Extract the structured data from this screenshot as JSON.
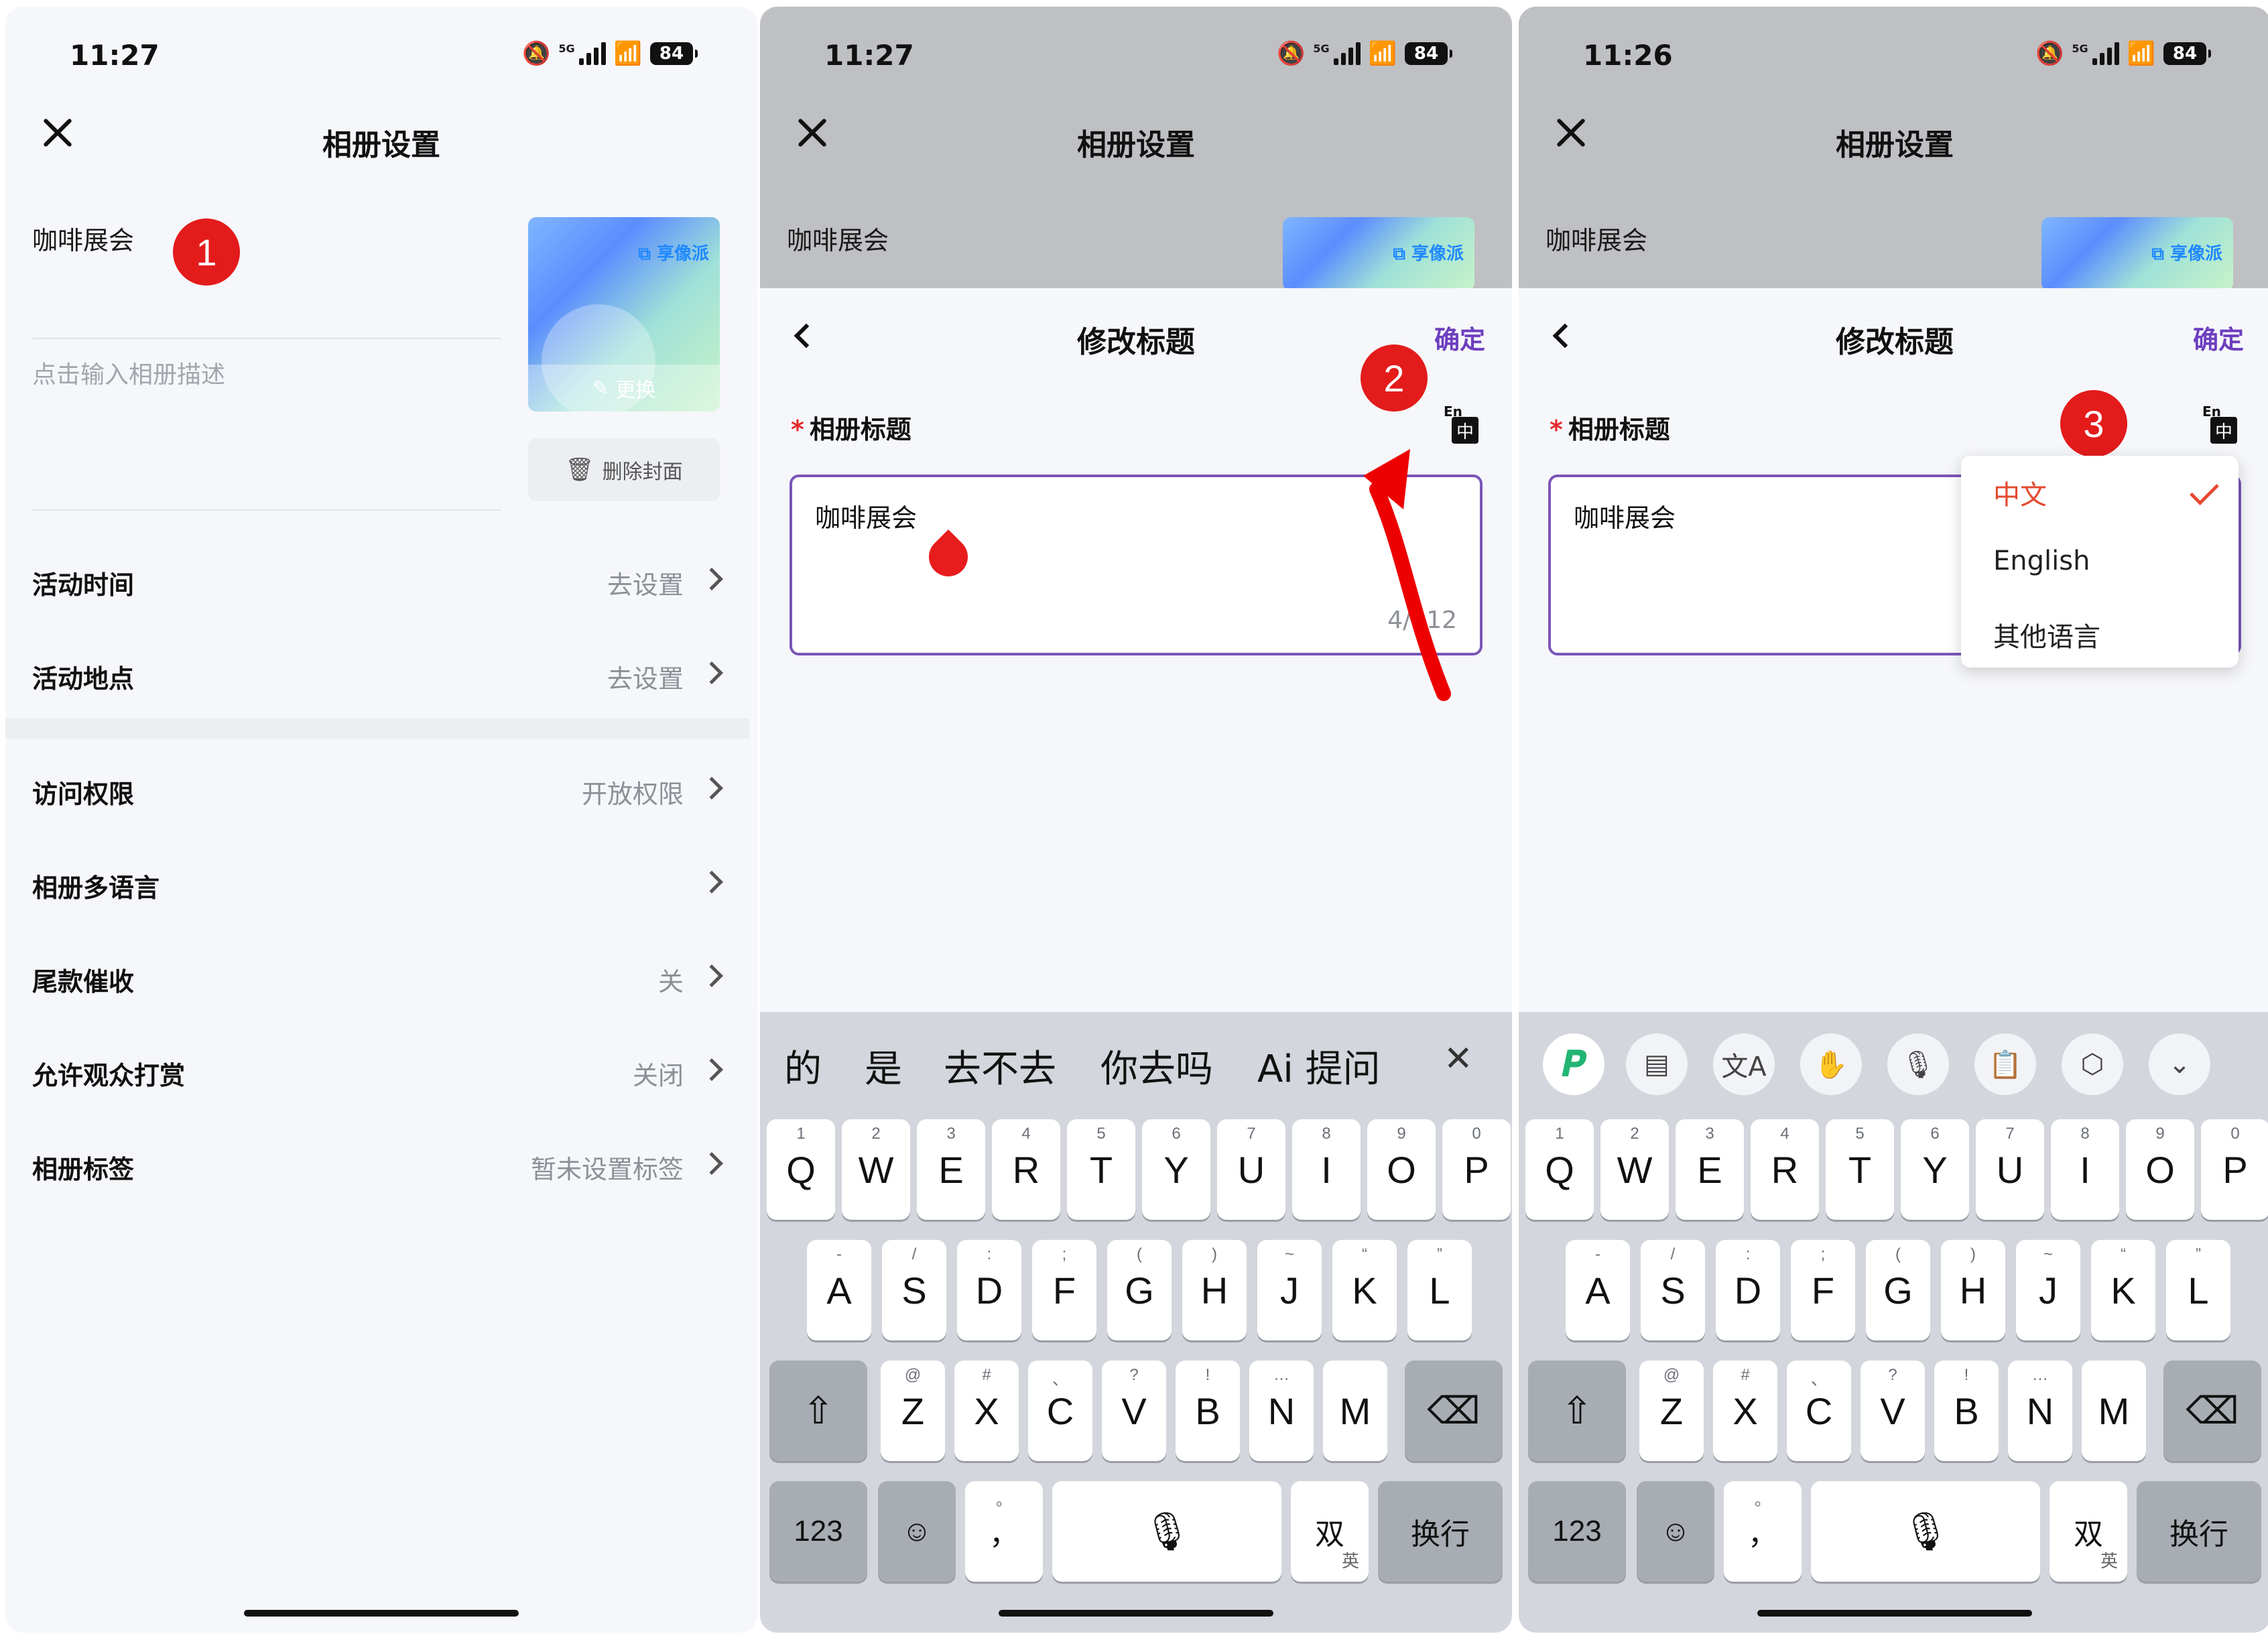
{
  "status": {
    "p1_time": "11:27",
    "p2_time": "11:27",
    "p3_time": "11:26",
    "network": "5G",
    "battery": "84"
  },
  "screen1": {
    "title": "相册设置",
    "album_name": "咖啡展会",
    "description_placeholder": "点击输入相册描述",
    "cover_watermark": "享像派",
    "cover_change": "更换",
    "delete_cover": "删除封面",
    "rows": [
      {
        "label": "活动时间",
        "value": "去设置"
      },
      {
        "label": "活动地点",
        "value": "去设置"
      },
      {
        "label": "访问权限",
        "value": "开放权限"
      },
      {
        "label": "相册多语言",
        "value": ""
      },
      {
        "label": "尾款催收",
        "value": "关"
      },
      {
        "label": "允许观众打赏",
        "value": "关闭"
      },
      {
        "label": "相册标签",
        "value": "暂未设置标签"
      }
    ],
    "badge": "1"
  },
  "sheet": {
    "title": "修改标题",
    "confirm": "确定",
    "field_label": "相册标题",
    "required_mark": "*",
    "value": "咖啡展会",
    "counter": "4/512",
    "lang_icon_en": "En",
    "lang_icon_zh": "中"
  },
  "screen2": {
    "badge": "2",
    "candidates": [
      "的",
      "是",
      "去不去",
      "你去吗",
      "Ai 提问"
    ]
  },
  "screen3": {
    "badge": "3",
    "menu": [
      {
        "label": "中文",
        "selected": true
      },
      {
        "label": "English",
        "selected": false
      },
      {
        "label": "其他语言",
        "selected": false
      }
    ]
  },
  "keyboard": {
    "row1": [
      {
        "k": "Q",
        "s": "1"
      },
      {
        "k": "W",
        "s": "2"
      },
      {
        "k": "E",
        "s": "3"
      },
      {
        "k": "R",
        "s": "4"
      },
      {
        "k": "T",
        "s": "5"
      },
      {
        "k": "Y",
        "s": "6"
      },
      {
        "k": "U",
        "s": "7"
      },
      {
        "k": "I",
        "s": "8"
      },
      {
        "k": "O",
        "s": "9"
      },
      {
        "k": "P",
        "s": "0"
      }
    ],
    "row2": [
      {
        "k": "A",
        "s": "-"
      },
      {
        "k": "S",
        "s": "/"
      },
      {
        "k": "D",
        "s": ":"
      },
      {
        "k": "F",
        "s": ";"
      },
      {
        "k": "G",
        "s": "("
      },
      {
        "k": "H",
        "s": ")"
      },
      {
        "k": "J",
        "s": "~"
      },
      {
        "k": "K",
        "s": "“"
      },
      {
        "k": "L",
        "s": "”"
      }
    ],
    "row3": [
      {
        "k": "Z",
        "s": "@"
      },
      {
        "k": "X",
        "s": "#"
      },
      {
        "k": "C",
        "s": "、"
      },
      {
        "k": "V",
        "s": "?"
      },
      {
        "k": "B",
        "s": "!"
      },
      {
        "k": "N",
        "s": "…"
      },
      {
        "k": "M",
        "s": ""
      }
    ],
    "num_key": "123",
    "punct_key": "，",
    "punct_sub": "。",
    "bilingual_key": "双",
    "bilingual_sub": "英",
    "enter_key": "换行"
  },
  "colors": {
    "accent": "#6d3fbf",
    "badge": "#e31b1b",
    "required": "#e32b2b",
    "menu_selected": "#e34a2e"
  }
}
